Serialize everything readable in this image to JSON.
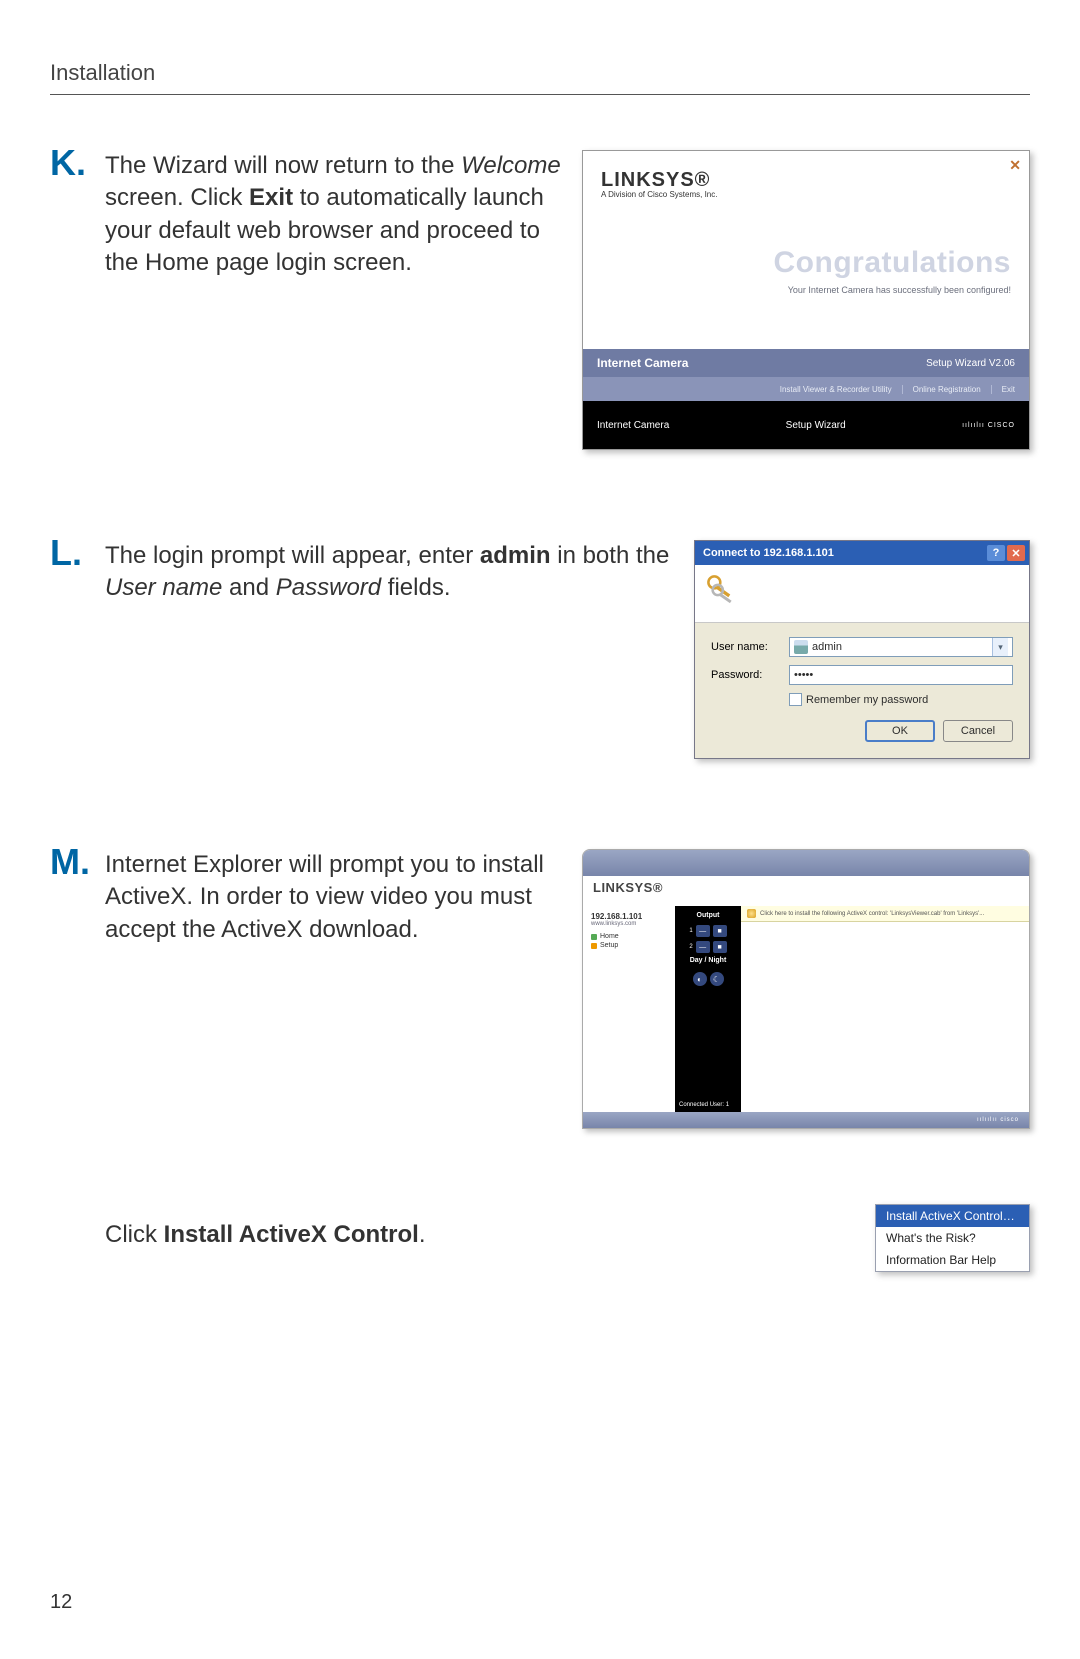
{
  "header": "Installation",
  "page_number": "12",
  "steps": {
    "K": {
      "letter": "K.",
      "text_pre": "The Wizard will now return to the ",
      "welcome": "Welcome",
      "text_mid": " screen. Click ",
      "exit": "Exit",
      "text_post": " to automatically launch your default web browser and proceed to the Home page login screen."
    },
    "L": {
      "letter": "L.",
      "text_pre": "The login prompt will appear, enter ",
      "admin": "admin",
      "text_mid1": " in both the ",
      "username": "User name",
      "text_mid2": " and ",
      "password": "Password",
      "text_post": " fields."
    },
    "M": {
      "letter": "M.",
      "text": "Internet Explorer will prompt you to install ActiveX. In order to view video you must accept the ActiveX download."
    },
    "M2": {
      "pre": "Click ",
      "bold": "Install ActiveX Control",
      "post": "."
    }
  },
  "figK": {
    "brand": "LINKSYS®",
    "brand_sub": "A Division of Cisco Systems, Inc.",
    "congrats": "Congratulations",
    "configured": "Your Internet Camera has successfully been configured!",
    "bar1_left": "Internet Camera",
    "bar1_right": "Setup Wizard  V2.06",
    "bar2_a": "Install Viewer & Recorder Utility",
    "bar2_b": "Online Registration",
    "bar2_c": "Exit",
    "bar3_left": "Internet Camera",
    "bar3_mid": "Setup Wizard",
    "bar3_cisco": "ıılıılıı CISCO"
  },
  "figL": {
    "title": "Connect to 192.168.1.101",
    "user_label": "User name:",
    "user_value": "admin",
    "pass_label": "Password:",
    "pass_value": "•••••",
    "remember": "Remember my password",
    "ok": "OK",
    "cancel": "Cancel"
  },
  "figM": {
    "brand": "LINKSYS®",
    "ip": "192.168.1.101",
    "link": "www.linksys.com",
    "nav_home": "Home",
    "nav_setup": "Setup",
    "panel_output": "Output",
    "panel_daynight": "Day / Night",
    "infobar": "Click here to install the following ActiveX control: 'LinksysViewer.cab' from 'Linksys'...",
    "connected": "Connected User: 1",
    "cisco": "ıılıılıı cisco"
  },
  "menu": {
    "install": "Install ActiveX Control…",
    "risk": "What's the Risk?",
    "help": "Information Bar Help"
  }
}
